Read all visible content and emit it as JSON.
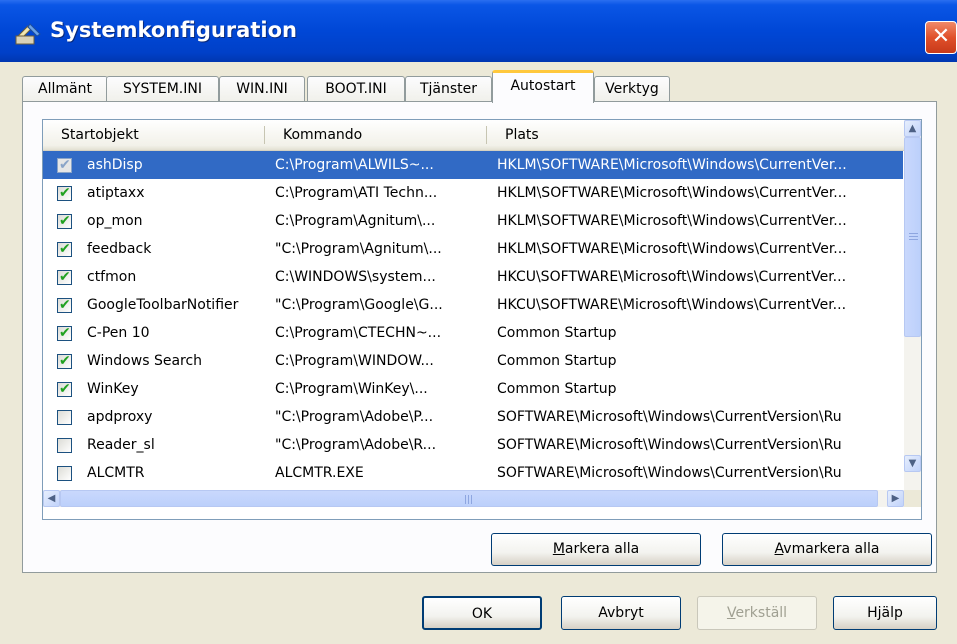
{
  "window": {
    "title": "Systemkonfiguration",
    "app_icon": "msconfig-icon",
    "close_label": "✕"
  },
  "tabs": [
    {
      "label": "Allmänt",
      "active": false
    },
    {
      "label": "SYSTEM.INI",
      "active": false
    },
    {
      "label": "WIN.INI",
      "active": false
    },
    {
      "label": "BOOT.INI",
      "active": false
    },
    {
      "label": "Tjänster",
      "active": false
    },
    {
      "label": "Autostart",
      "active": true
    },
    {
      "label": "Verktyg",
      "active": false
    }
  ],
  "list": {
    "columns": [
      "Startobjekt",
      "Kommando",
      "Plats"
    ],
    "rows": [
      {
        "name": "ashDisp",
        "command": "C:\\Program\\ALWILS~...",
        "location": "HKLM\\SOFTWARE\\Microsoft\\Windows\\CurrentVer...",
        "checked": true,
        "selected": true
      },
      {
        "name": "atiptaxx",
        "command": "C:\\Program\\ATI Techn...",
        "location": "HKLM\\SOFTWARE\\Microsoft\\Windows\\CurrentVer...",
        "checked": true,
        "selected": false
      },
      {
        "name": "op_mon",
        "command": "C:\\Program\\Agnitum\\...",
        "location": "HKLM\\SOFTWARE\\Microsoft\\Windows\\CurrentVer...",
        "checked": true,
        "selected": false
      },
      {
        "name": "feedback",
        "command": "\"C:\\Program\\Agnitum\\...",
        "location": "HKLM\\SOFTWARE\\Microsoft\\Windows\\CurrentVer...",
        "checked": true,
        "selected": false
      },
      {
        "name": "ctfmon",
        "command": "C:\\WINDOWS\\system...",
        "location": "HKCU\\SOFTWARE\\Microsoft\\Windows\\CurrentVer...",
        "checked": true,
        "selected": false
      },
      {
        "name": "GoogleToolbarNotifier",
        "command": "\"C:\\Program\\Google\\G...",
        "location": "HKCU\\SOFTWARE\\Microsoft\\Windows\\CurrentVer...",
        "checked": true,
        "selected": false
      },
      {
        "name": "C-Pen 10",
        "command": "C:\\Program\\CTECHN~...",
        "location": "Common Startup",
        "checked": true,
        "selected": false
      },
      {
        "name": "Windows Search",
        "command": "C:\\Program\\WINDOW...",
        "location": "Common Startup",
        "checked": true,
        "selected": false
      },
      {
        "name": "WinKey",
        "command": "C:\\Program\\WinKey\\...",
        "location": "Common Startup",
        "checked": true,
        "selected": false
      },
      {
        "name": "apdproxy",
        "command": "\"C:\\Program\\Adobe\\P...",
        "location": "SOFTWARE\\Microsoft\\Windows\\CurrentVersion\\Ru",
        "checked": false,
        "selected": false
      },
      {
        "name": "Reader_sl",
        "command": "\"C:\\Program\\Adobe\\R...",
        "location": "SOFTWARE\\Microsoft\\Windows\\CurrentVersion\\Ru",
        "checked": false,
        "selected": false
      },
      {
        "name": "ALCMTR",
        "command": "ALCMTR.EXE",
        "location": "SOFTWARE\\Microsoft\\Windows\\CurrentVersion\\Ru",
        "checked": false,
        "selected": false
      }
    ]
  },
  "buttons": {
    "select_all": {
      "pre": "",
      "key": "M",
      "post": "arkera alla"
    },
    "deselect_all": {
      "pre": "",
      "key": "A",
      "post": "vmarkera alla"
    },
    "ok": "OK",
    "cancel": "Avbryt",
    "apply": {
      "pre": "",
      "key": "V",
      "post": "erkställ"
    },
    "help": "Hjälp"
  },
  "colors": {
    "titlebar": "#0047d6",
    "selection": "#316ac5",
    "active_tab_accent": "#ffc83c",
    "checkbox_check": "#21a121"
  }
}
